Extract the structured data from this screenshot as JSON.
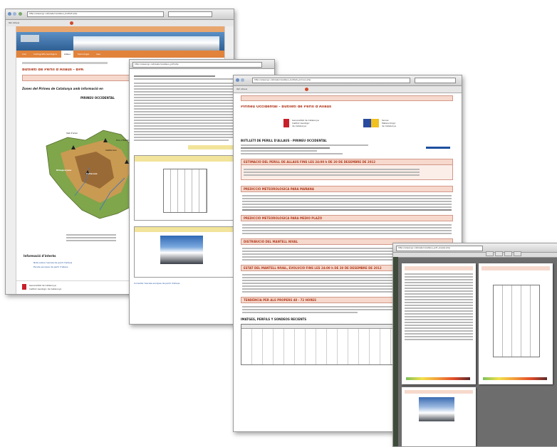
{
  "window1": {
    "address": "http://www.igc.cat/web/ca/allaus_butlleti.php",
    "tab": "IGC Allaus",
    "nav_tabs": [
      "Inici",
      "Cartografia Geològica",
      "Allaus",
      "Sismologia",
      "Geo"
    ],
    "page_title": "Butlletí de Perill d'Allaus - BPA",
    "subtitle": "Zones del Pirineu de Catalunya amb informació en",
    "map_title": "PIRINEU OCCIDENTAL",
    "map_labels": [
      "Vall d'Aran",
      "Ribagorçana",
      "Pallaresa",
      "Vallferrera",
      "Pica d'Estats"
    ],
    "links_title": "Informació d'interès",
    "links": [
      "Nota sobre l'escala de perill d'allaus",
      "Escala europea de perill d'allaus"
    ],
    "footer": [
      "Generalitat de Catalunya",
      "Institut Geològic de Catalunya"
    ]
  },
  "window2": {
    "address": "http://www.igc.cat/web/ca/allaus_pdf.php",
    "caption": "Consulta l'escala europea de perill d'allaus"
  },
  "window3": {
    "address": "http://www.igc.cat/web/ca/allaus_butlleti_pirineu.php",
    "tab": "IGC Allaus",
    "page_title": "Pirineu Occidental - Butlletí de Perill d'Allaus",
    "logo_left": "Generalitat de Catalunya\nInstitut Geològic\nde Catalunya",
    "logo_right": "Servei\nMeteorològic\nde Catalunya",
    "report_title": "BUTLLETÍ DE PERILL D'ALLAUS - PIRINEU OCCIDENTAL",
    "sections": [
      "ESTIMACIÓ DEL PERILL DE ALLAUS FINS LES 24:00 h DE 20 DE DESEMBRE DE 2012",
      "PREDICCIÓ METEOROLÒGICA PARA MAÑANA",
      "PREDICCIÓ METEOROLÒGICA PARA MEDIO PLAZO",
      "DISTRIBUCIÓ DEL MANTELL NIVAL",
      "ESTAT DEL MANTELL NIVAL, EVOLUCIÓ FINS LES 24:00 h DE 20 DE DESEMBRE DE 2012",
      "TENDÈNCIA PER ALS PROPERS 48 - 72 HORES",
      "IMATGES, PERFILS Y SONDEOS RECIENTS"
    ]
  },
  "window4": {
    "address": "http://www.igc.cat/web/ca/allaus_pdf_viewer.php"
  },
  "colors": {
    "accent": "#b23a1e",
    "section_bg": "#f6d9cc",
    "nav_orange": "#e1833b",
    "banner_blue": "#3a78b0"
  }
}
